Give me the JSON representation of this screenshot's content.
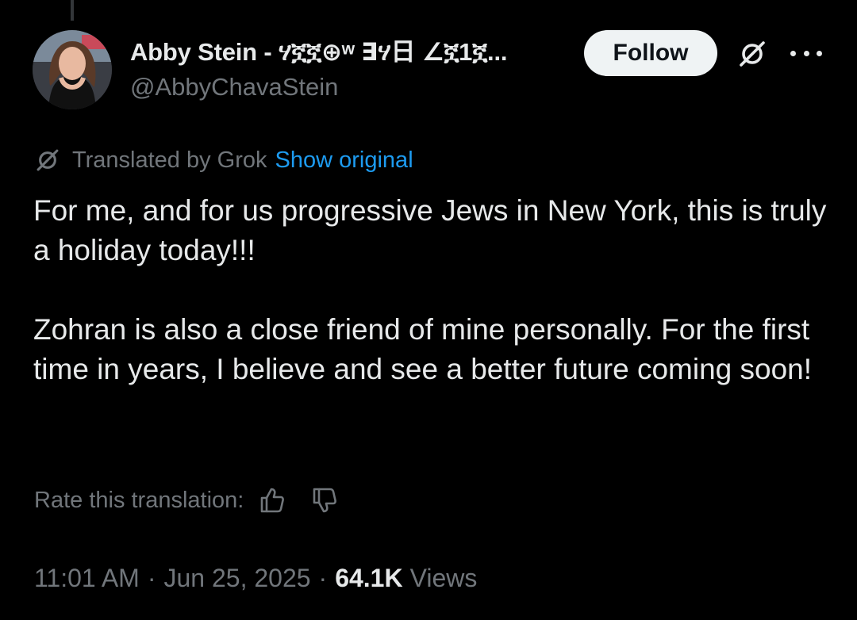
{
  "tweet": {
    "author": {
      "display_name": "Abby Stein - 𐤀𐤁𐤉 ...",
      "display_name_text": "Abby Stein - ",
      "display_name_script": "ሃኟኟ⊕ʷ ∃ሃ日 ∠ኟ1ኟ...",
      "handle": "@AbbyChavaStein",
      "avatar_icon": "avatar-photo"
    },
    "follow_label": "Follow",
    "icons": {
      "grok": "grok-icon",
      "more": "more-dots-icon",
      "thumbs_up": "thumbs-up-icon",
      "thumbs_down": "thumbs-down-icon"
    },
    "translation": {
      "label": "Translated by Grok",
      "show_original": "Show original"
    },
    "body": {
      "paragraph_1": "For me, and for us progressive Jews in New York, this is truly a holiday today!!!",
      "paragraph_2": "Zohran is also a close friend of mine personally. For the first time in years, I believe and see a better future coming soon!"
    },
    "rate_label": "Rate this translation:",
    "meta": {
      "time": "11:01 AM",
      "separator": "·",
      "date": "Jun 25, 2025",
      "views_count": "64.1K",
      "views_label": "Views"
    }
  },
  "colors": {
    "background": "#000000",
    "text_primary": "#e7e9ea",
    "text_secondary": "#71767b",
    "link_blue": "#1d9bf0",
    "follow_bg": "#eff3f4"
  }
}
